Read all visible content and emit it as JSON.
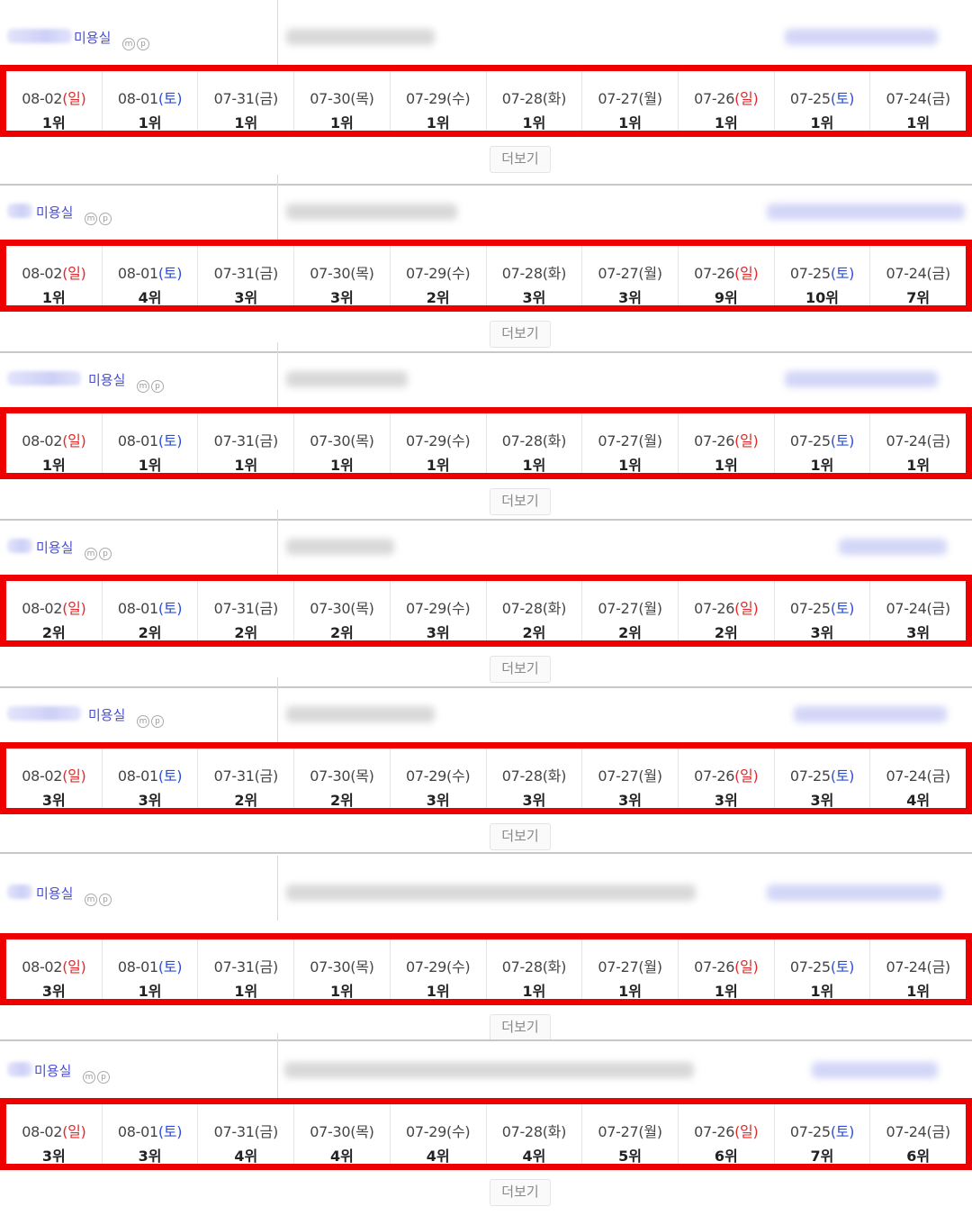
{
  "more_label": "더보기",
  "shop_label": "미용실",
  "icon_m": "m",
  "icon_p": "p",
  "colors": {
    "frame": "#ee0000",
    "sunday": "#e02a2a",
    "saturday": "#2b4dd8",
    "shop": "#4a4fd0"
  },
  "dates": [
    {
      "date": "08-02",
      "wd": "일",
      "type": "sun"
    },
    {
      "date": "08-01",
      "wd": "토",
      "type": "sat"
    },
    {
      "date": "07-31",
      "wd": "금",
      "type": "wk"
    },
    {
      "date": "07-30",
      "wd": "목",
      "type": "wk"
    },
    {
      "date": "07-29",
      "wd": "수",
      "type": "wk"
    },
    {
      "date": "07-28",
      "wd": "화",
      "type": "wk"
    },
    {
      "date": "07-27",
      "wd": "월",
      "type": "wk"
    },
    {
      "date": "07-26",
      "wd": "일",
      "type": "sun"
    },
    {
      "date": "07-25",
      "wd": "토",
      "type": "sat"
    },
    {
      "date": "07-24",
      "wd": "금",
      "type": "wk"
    }
  ],
  "blocks": [
    {
      "ranks": [
        "1위",
        "1위",
        "1위",
        "1위",
        "1위",
        "1위",
        "1위",
        "1위",
        "1위",
        "1위"
      ]
    },
    {
      "ranks": [
        "1위",
        "4위",
        "3위",
        "3위",
        "2위",
        "3위",
        "3위",
        "9위",
        "10위",
        "7위"
      ]
    },
    {
      "ranks": [
        "1위",
        "1위",
        "1위",
        "1위",
        "1위",
        "1위",
        "1위",
        "1위",
        "1위",
        "1위"
      ]
    },
    {
      "ranks": [
        "2위",
        "2위",
        "2위",
        "2위",
        "3위",
        "2위",
        "2위",
        "2위",
        "3위",
        "3위"
      ]
    },
    {
      "ranks": [
        "3위",
        "3위",
        "2위",
        "2위",
        "3위",
        "3위",
        "3위",
        "3위",
        "3위",
        "4위"
      ]
    },
    {
      "ranks": [
        "3위",
        "1위",
        "1위",
        "1위",
        "1위",
        "1위",
        "1위",
        "1위",
        "1위",
        "1위"
      ]
    },
    {
      "ranks": [
        "3위",
        "3위",
        "4위",
        "4위",
        "4위",
        "4위",
        "5위",
        "6위",
        "7위",
        "6위"
      ]
    }
  ]
}
